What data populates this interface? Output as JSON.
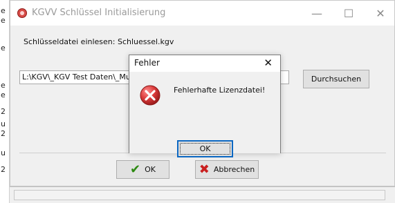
{
  "background": {
    "left_glyphs": [
      "e",
      "e",
      "e",
      "e",
      "e",
      "2",
      "u",
      "2",
      "u",
      "2"
    ]
  },
  "main_window": {
    "title": "KGVV Schlüssel Initialisierung",
    "controls": {
      "minimize": "—",
      "maximize": "☐",
      "close": "✕"
    },
    "label": "Schlüsseldatei einlesen: Schluessel.kgv",
    "path_value": "L:\\KGV\\_KGV Test Daten\\_Mus",
    "browse_label": "Durchsuchen",
    "ok_label": "OK",
    "cancel_label": "Abbrechen",
    "icons": {
      "app": "app-icon",
      "check": "check-icon",
      "cancel": "red-x-icon"
    },
    "colors": {
      "title_text": "#9a9a9a",
      "window_bg": "#f0f0f0",
      "button_bg": "#e1e1e1"
    }
  },
  "error_dialog": {
    "title": "Fehler",
    "close": "✕",
    "message": "Fehlerhafte Lizenzdatei!",
    "ok_label": "OK",
    "icon": "error-icon",
    "colors": {
      "error_red": "#d83b3b",
      "focus_border": "#0b67c2"
    }
  }
}
